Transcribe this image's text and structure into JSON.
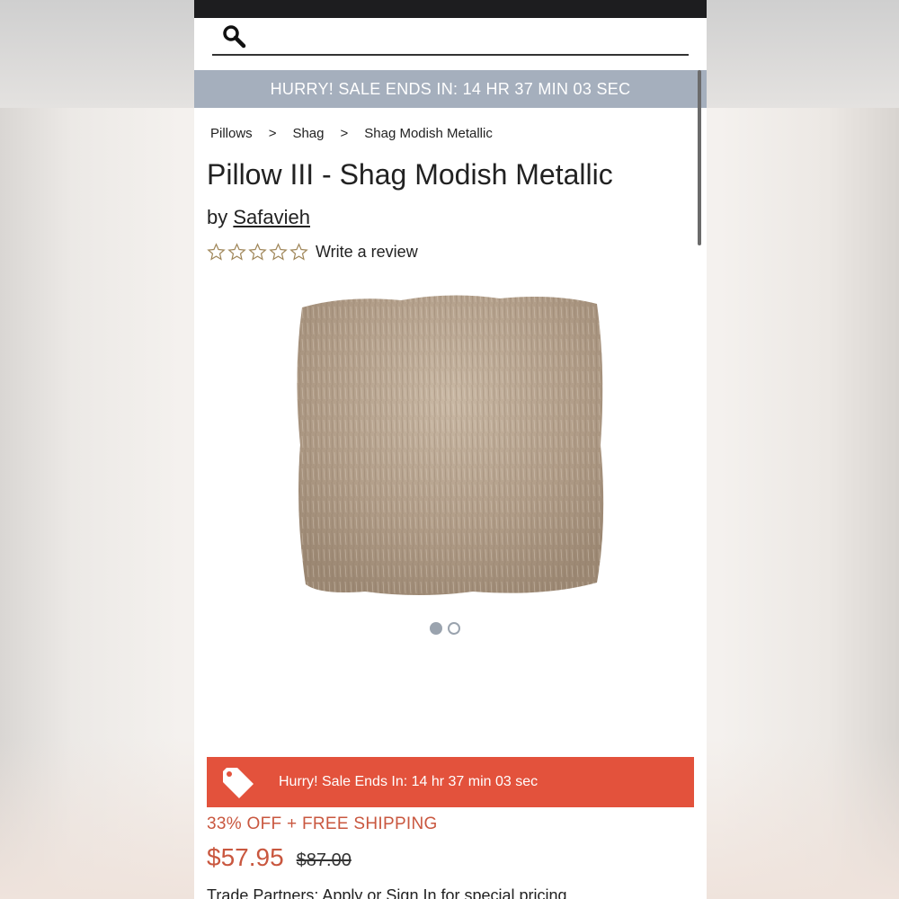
{
  "search": {
    "placeholder": "",
    "value": ""
  },
  "top_banner": {
    "text": "HURRY! SALE ENDS IN: 14 HR  37 MIN  03 SEC"
  },
  "breadcrumb": {
    "items": [
      "Pillows",
      "Shag",
      "Shag Modish Metallic"
    ],
    "separator": ">"
  },
  "product": {
    "title": "Pillow III - Shag Modish Metallic",
    "by_prefix": "by",
    "brand": "Safavieh",
    "rating_stars": 0,
    "rating_max": 5,
    "review_link": "Write a review",
    "image_count": 2,
    "image_active_index": 0
  },
  "sale_banner": {
    "text": "Hurry! Sale Ends In: 14 hr  37 min  03 sec",
    "icon": "price-tag-icon"
  },
  "promo": {
    "text": "33% OFF + FREE SHIPPING"
  },
  "pricing": {
    "current": "$57.95",
    "original": "$87.00"
  },
  "trade": {
    "text": "Trade Partners: Apply or Sign In for special pricing"
  },
  "colors": {
    "accent_red": "#e3523c",
    "price_red": "#c9573f",
    "banner_gray": "#a5afbd",
    "status_bar": "#1d1d1f",
    "dot_gray": "#9aa3ae"
  }
}
